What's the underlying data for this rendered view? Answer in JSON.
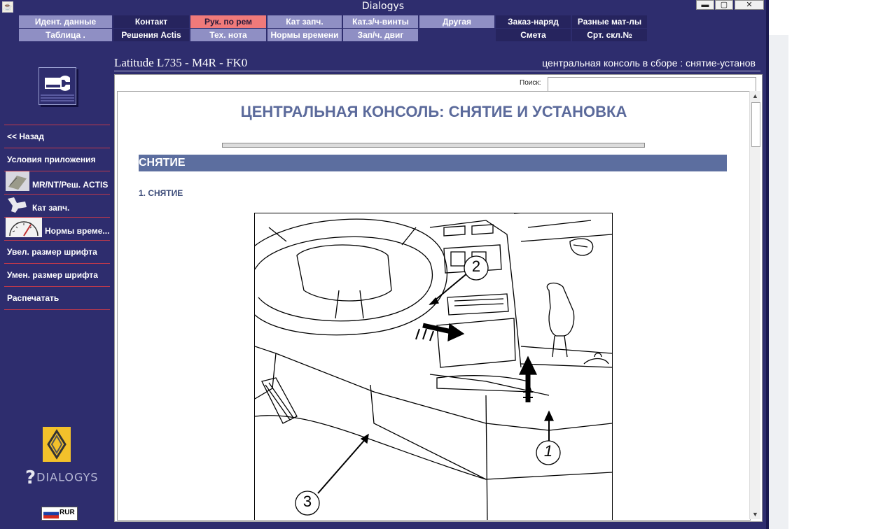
{
  "window": {
    "title": "Dialogys",
    "app_icon": "java-cup-icon"
  },
  "menu": {
    "row1": [
      {
        "label": "Идент. данные",
        "style": "light"
      },
      {
        "label": "Контакт",
        "style": "dark"
      },
      {
        "label": "Рук. по рем",
        "style": "active"
      },
      {
        "label": "Кат запч.",
        "style": "light"
      },
      {
        "label": "Кат.з/ч-винты",
        "style": "light"
      },
      {
        "label": "Другая",
        "style": "light"
      },
      {
        "label": "Заказ-наряд",
        "style": "dark"
      },
      {
        "label": "Разные мат-лы",
        "style": "dark"
      }
    ],
    "row2": [
      {
        "label": "Таблица .",
        "style": "light"
      },
      {
        "label": "Решения Actis",
        "style": "dark"
      },
      {
        "label": "Тех. нота",
        "style": "light"
      },
      {
        "label": "Нормы времени",
        "style": "light"
      },
      {
        "label": "Зап/ч. двиг",
        "style": "light"
      },
      {
        "label": "Смета",
        "style": "dark"
      },
      {
        "label": "Срт. скл.№",
        "style": "dark"
      }
    ]
  },
  "sidebar": {
    "items": [
      {
        "label": "<< Назад"
      },
      {
        "label": "Условия приложения"
      },
      {
        "label": "MR/NT/Реш. ACTIS",
        "icon": "manual-book-icon"
      },
      {
        "label": "Кат запч.",
        "icon": "parts-icon"
      },
      {
        "label": "Нормы време...",
        "icon": "speedometer-icon"
      },
      {
        "label": "Увел. размер шрифта"
      },
      {
        "label": "Умен. размер шрифта"
      },
      {
        "label": "Распечатать"
      }
    ],
    "brand": "DIALOGYS",
    "currency": "RUR"
  },
  "header": {
    "model": "Latitude L735 - M4R - FK0",
    "breadcrumb": "центральная консоль в сборе : снятие-установ"
  },
  "search": {
    "label": "Поиск:",
    "value": ""
  },
  "document": {
    "title": "ЦЕНТРАЛЬНАЯ КОНСОЛЬ: СНЯТИЕ И УСТАНОВКА",
    "section": "СНЯТИЕ",
    "subheading": "1. СНЯТИЕ",
    "callouts": [
      "1",
      "2",
      "3"
    ]
  },
  "colors": {
    "window_bg": "#2e2d6e",
    "tab_light": "#8f8fc4",
    "tab_dark": "#26245e",
    "tab_active": "#f07a7a",
    "section_bar": "#5c6e9f",
    "title_blue": "#5b6a9b",
    "separator_red": "#c0394b"
  }
}
